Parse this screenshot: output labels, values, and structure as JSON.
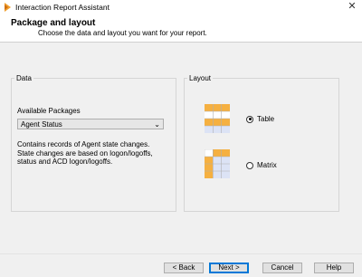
{
  "window": {
    "title": "Interaction Report Assistant",
    "close_glyph": "✕"
  },
  "header": {
    "title": "Package and layout",
    "subtitle": "Choose the data and layout you want for your report."
  },
  "data_group": {
    "legend": "Data",
    "packages_label": "Available Packages",
    "selected_package": "Agent Status",
    "description": "Contains records of Agent state changes. State changes are based on logon/logoffs, status and ACD logon/logoffs."
  },
  "layout_group": {
    "legend": "Layout",
    "options": [
      {
        "label": "Table",
        "selected": true,
        "icon": "table-layout-icon"
      },
      {
        "label": "Matrix",
        "selected": false,
        "icon": "matrix-layout-icon"
      }
    ]
  },
  "buttons": {
    "back": "< Back",
    "next": "Next >",
    "cancel": "Cancel",
    "help": "Help"
  },
  "colors": {
    "accent": "#0078d7",
    "orange": "#f5b041",
    "grid_blue": "#dce3f5"
  }
}
